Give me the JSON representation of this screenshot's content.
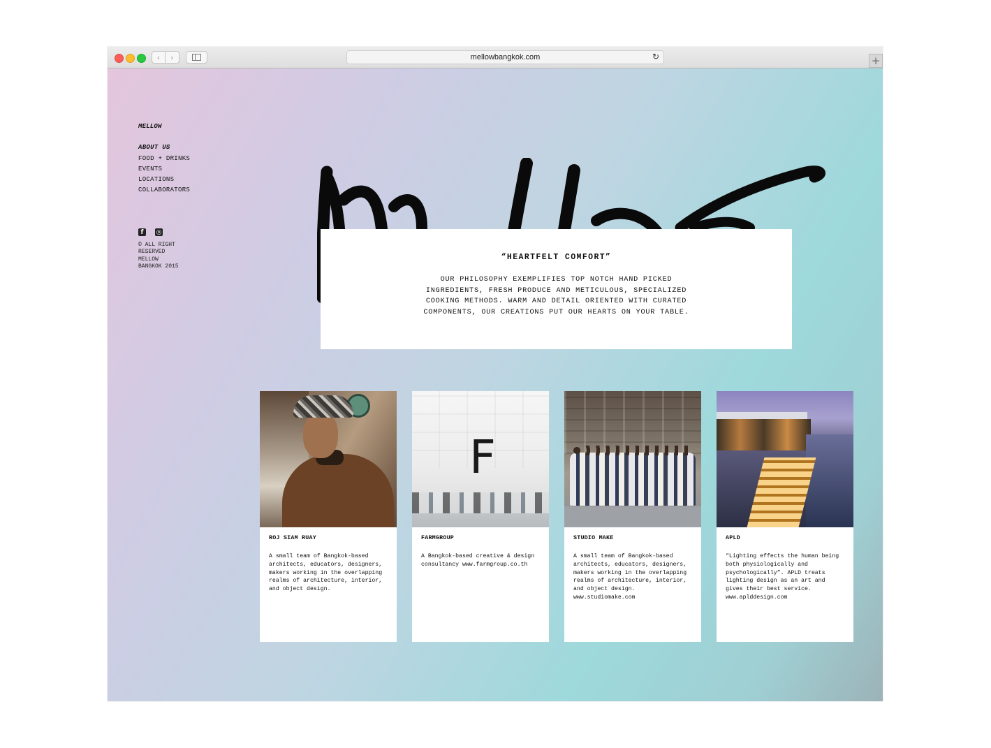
{
  "browser": {
    "url": "mellowbangkok.com",
    "back_icon": "‹",
    "forward_icon": "›",
    "reload_icon": "↻",
    "newtab_icon": "+"
  },
  "sidebar": {
    "brand": "MELLOW",
    "nav": [
      "ABOUT US",
      "FOOD + DRINKS",
      "EVENTS",
      "LOCATIONS",
      "COLLABORATORS"
    ],
    "social": [
      "facebook-icon",
      "instagram-icon"
    ],
    "social_glyphs": [
      "f",
      "◎"
    ],
    "copyright": "© ALL RIGHT RESERVED MELLOW BANGKOK 2015"
  },
  "hero": {
    "title": "“HEARTFELT COMFORT”",
    "body": "OUR PHILOSOPHY EXEMPLIFIES TOP NOTCH HAND PICKED INGREDIENTS, FRESH PRODUCE AND METICULOUS, SPECIALIZED COOKING METHODS. WARM AND DETAIL ORIENTED WITH CURATED COMPONENTS, OUR CREATIONS PUT OUR HEARTS ON YOUR TABLE."
  },
  "collaborators": [
    {
      "name": "ROJ SIAM RUAY",
      "description": "A small team of Bangkok-based architects, educators, designers, makers working in the overlapping realms of architecture, interior, and object design."
    },
    {
      "name": "FARMGROUP",
      "photo_letter": "F",
      "description": "A Bangkok-based creative & design consultancy www.farmgroup.co.th"
    },
    {
      "name": "STUDIO MAKE",
      "description": "A small team of Bangkok-based architects, educators, designers, makers working in the overlapping realms of architecture, interior, and object design. www.studiomake.com"
    },
    {
      "name": "APLD",
      "description": "“Lighting effects the human being both physiologically and psychologically”. APLD treats lighting design as an art and gives their best service. www.aplddesign.com"
    }
  ]
}
